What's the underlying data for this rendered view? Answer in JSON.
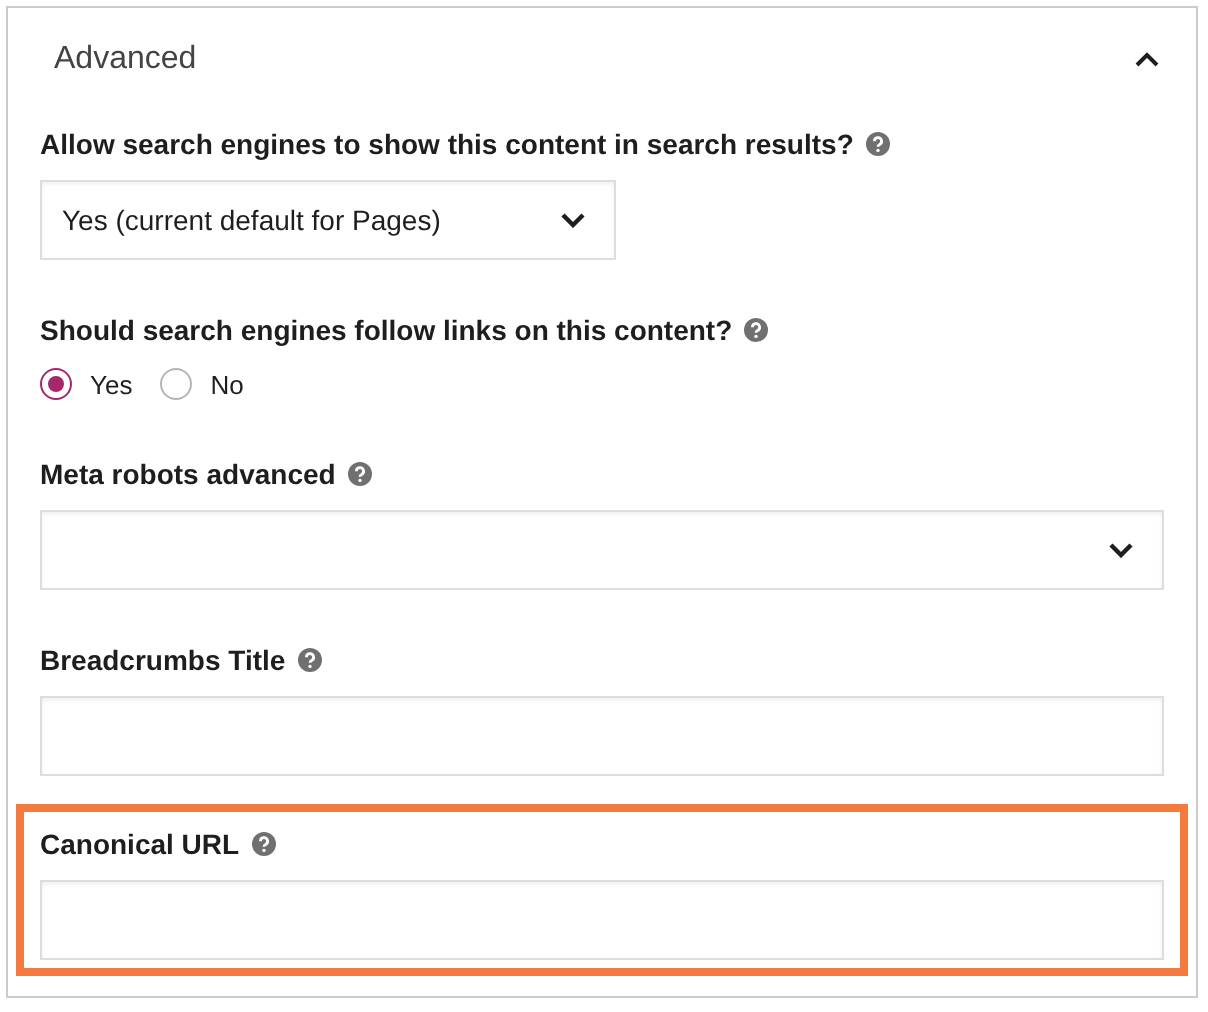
{
  "section": {
    "title": "Advanced",
    "expanded": true
  },
  "fields": [
    {
      "kind": "select",
      "label": "Allow search engines to show this content in search results?",
      "help": true,
      "value": "Yes (current default for Pages)",
      "highlighted": false
    },
    {
      "kind": "radio",
      "label": "Should search engines follow links on this content?",
      "help": true,
      "options": [
        {
          "label": "Yes",
          "selected": true
        },
        {
          "label": "No",
          "selected": false
        }
      ],
      "highlighted": false
    },
    {
      "kind": "select",
      "label": "Meta robots advanced",
      "help": true,
      "highlighted": false
    },
    {
      "kind": "text",
      "label": "Breadcrumbs Title",
      "help": true,
      "highlighted": false
    },
    {
      "kind": "text",
      "label": "Canonical URL",
      "help": true,
      "highlighted": true
    }
  ]
}
